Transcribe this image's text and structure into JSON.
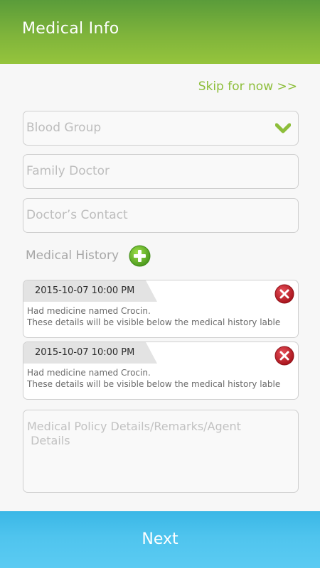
{
  "header": {
    "title": "Medical Info"
  },
  "skip_label": "Skip for now >>",
  "form": {
    "blood_group_placeholder": "Blood Group",
    "family_doctor_placeholder": "Family Doctor",
    "doctor_contact_placeholder": "Doctor’s Contact",
    "medical_history_label": "Medical History",
    "remarks_placeholder": "Medical Policy Details/Remarks/Agent\n Details"
  },
  "history": [
    {
      "date": "2015-10-07 10:00 PM",
      "line1": "Had medicine named Crocin.",
      "line2": "These details will be visible below the medical history lable"
    },
    {
      "date": "2015-10-07 10:00 PM",
      "line1": "Had medicine named Crocin.",
      "line2": "These details will be visible below the medical history lable"
    }
  ],
  "icons": {
    "dropdown": "chevron-down-icon",
    "add": "plus-circle-icon",
    "delete": "close-circle-icon"
  },
  "colors": {
    "header_green": "#7fb43b",
    "accent_green": "#8dbe3a",
    "delete_red": "#c8202a",
    "button_blue": "#4fc4ee"
  },
  "footer": {
    "next_label": "Next"
  }
}
